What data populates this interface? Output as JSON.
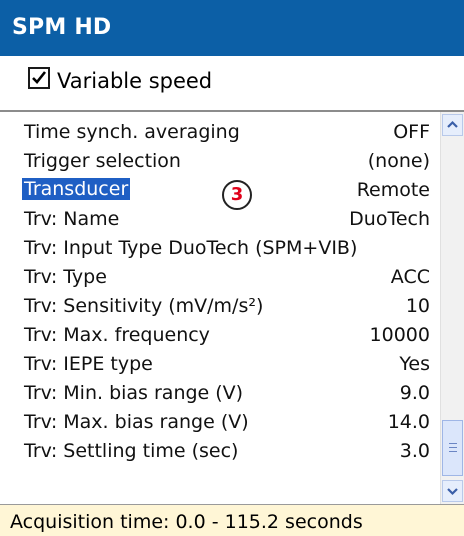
{
  "window": {
    "title": "SPM HD"
  },
  "variable_speed": {
    "label": "Variable speed",
    "checked": true
  },
  "settings": [
    {
      "label": "Time synch. averaging",
      "value": "OFF"
    },
    {
      "label": "Trigger selection",
      "value": "(none)"
    },
    {
      "label": "Transducer",
      "value": "Remote"
    },
    {
      "label": "Trv: Name",
      "value": "DuoTech"
    },
    {
      "label": "Trv: Input Type DuoTech (SPM+VIB)",
      "value": ""
    },
    {
      "label": "Trv: Type",
      "value": "ACC"
    },
    {
      "label": "Trv: Sensitivity (mV/m/s²)",
      "value": "10"
    },
    {
      "label": "Trv: Max. frequency",
      "value": "10000"
    },
    {
      "label": "Trv: IEPE type",
      "value": "Yes"
    },
    {
      "label": "Trv: Min. bias range (V)",
      "value": "9.0"
    },
    {
      "label": "Trv: Max. bias range (V)",
      "value": "14.0"
    },
    {
      "label": "Trv: Settling time (sec)",
      "value": "3.0"
    }
  ],
  "callout": {
    "number": "3"
  },
  "status": {
    "text": "Acquisition time: 0.0 - 115.2 seconds"
  },
  "colors": {
    "titlebar": "#0c5fa6",
    "selection": "#1f5fc4",
    "callout_number": "#e0001a",
    "statusbar": "#fff6d6"
  }
}
